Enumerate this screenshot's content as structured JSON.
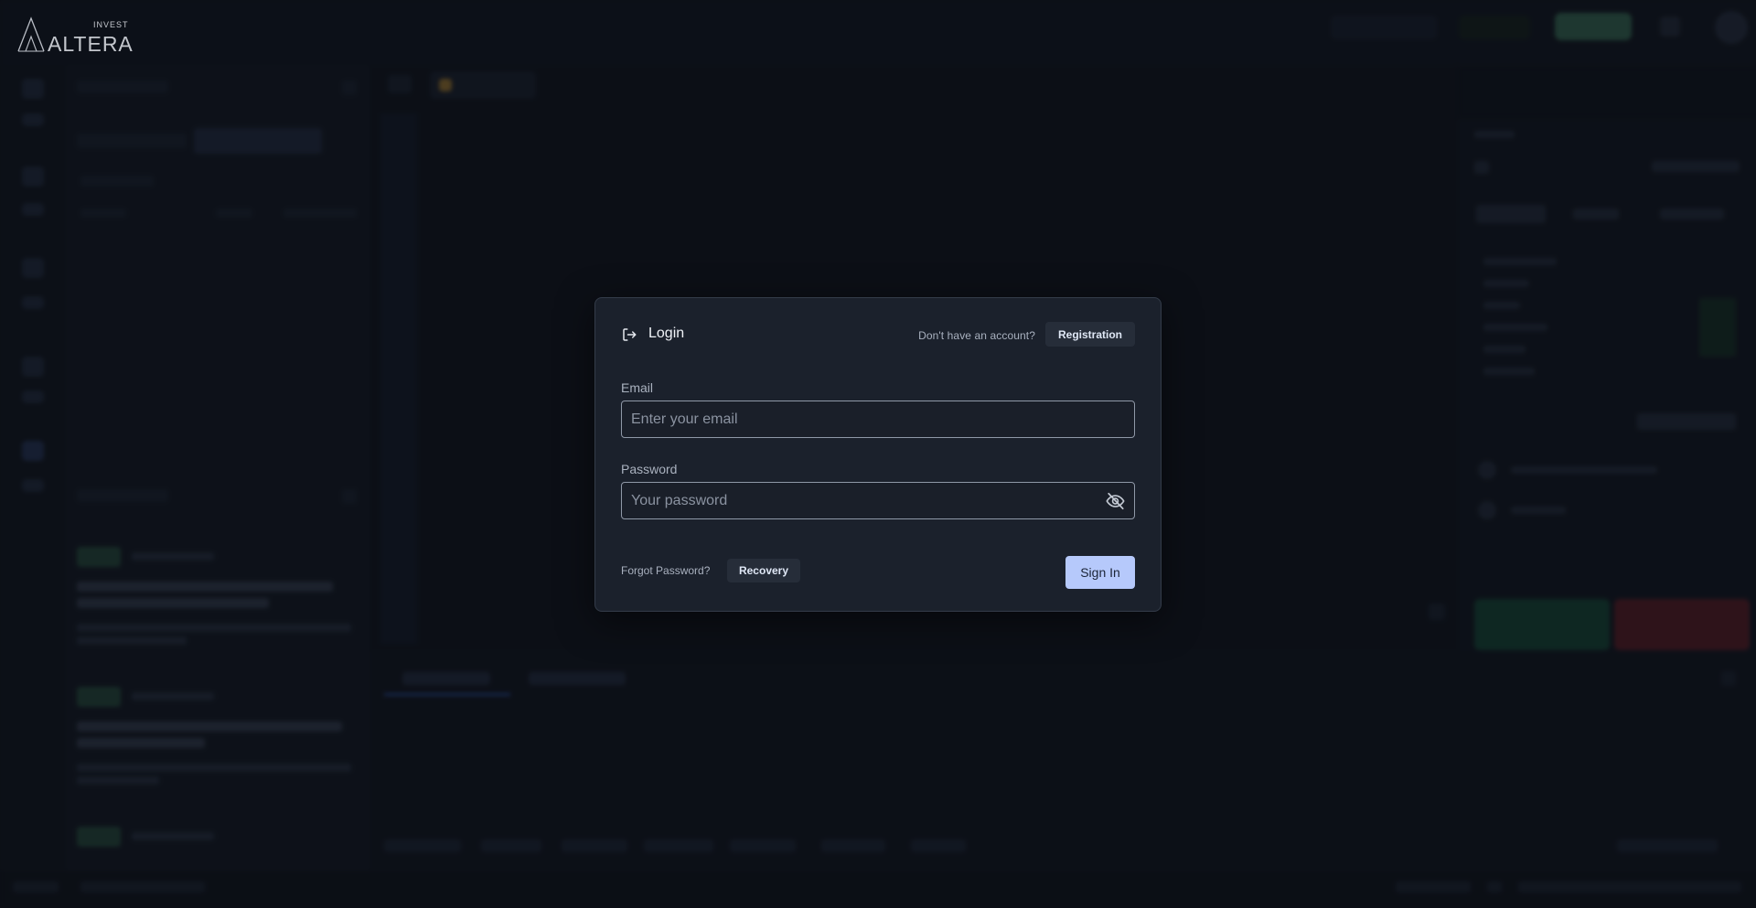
{
  "brand": {
    "logo_text": "ALTERA",
    "logo_subtext": "INVEST"
  },
  "login": {
    "title": "Login",
    "no_account_text": "Don't have an account?",
    "registration_label": "Registration",
    "email": {
      "label": "Email",
      "placeholder": "Enter your email",
      "value": ""
    },
    "password": {
      "label": "Password",
      "placeholder": "Your password",
      "value": ""
    },
    "forgot_text": "Forgot Password?",
    "recovery_label": "Recovery",
    "signin_label": "Sign In"
  },
  "colors": {
    "accent": "#b6c9fb",
    "modal_bg": "#1b212c",
    "page_bg": "#0f131b",
    "buy": "#16513b",
    "sell": "#6a1f27"
  },
  "icons": {
    "login": "login-arrow-icon",
    "password_visibility": "eye-off-icon"
  }
}
